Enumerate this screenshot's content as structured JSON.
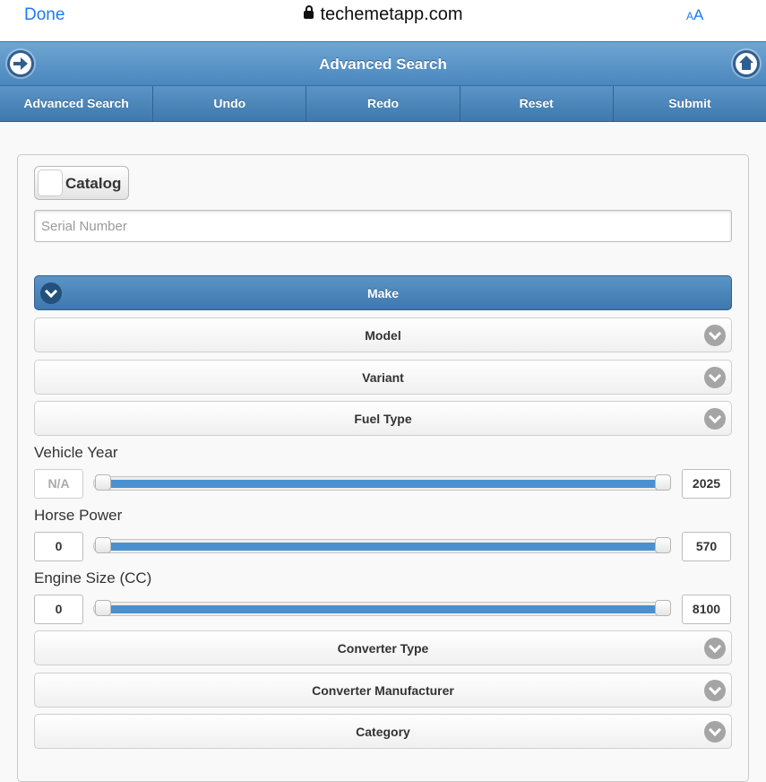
{
  "browser": {
    "done_label": "Done",
    "url": "techemetapp.com",
    "text_size_label_small": "A",
    "text_size_label_large": "A"
  },
  "header": {
    "title": "Advanced Search"
  },
  "navbar": {
    "items": [
      {
        "label": "Advanced Search"
      },
      {
        "label": "Undo"
      },
      {
        "label": "Redo"
      },
      {
        "label": "Reset"
      },
      {
        "label": "Submit"
      }
    ]
  },
  "form": {
    "catalog_label": "Catalog",
    "catalog_enabled": false,
    "serial_number": {
      "value": "",
      "placeholder": "Serial Number"
    },
    "sections": [
      {
        "label": "Make",
        "expanded": true
      },
      {
        "label": "Model",
        "expanded": false
      },
      {
        "label": "Variant",
        "expanded": false
      },
      {
        "label": "Fuel Type",
        "expanded": false
      }
    ],
    "sliders": [
      {
        "label": "Vehicle Year",
        "min_value": "N/A",
        "max_value": "2025",
        "min_disabled": true,
        "range_fraction": [
          0,
          1
        ]
      },
      {
        "label": "Horse Power",
        "min_value": "0",
        "max_value": "570",
        "min_disabled": false,
        "range_fraction": [
          0,
          1
        ]
      },
      {
        "label": "Engine Size (CC)",
        "min_value": "0",
        "max_value": "8100",
        "min_disabled": false,
        "range_fraction": [
          0,
          1
        ]
      }
    ],
    "lower_sections": [
      {
        "label": "Converter Type",
        "expanded": false
      },
      {
        "label": "Converter Manufacturer",
        "expanded": false
      },
      {
        "label": "Category",
        "expanded": false
      }
    ]
  },
  "colors": {
    "accent": "#4a87be",
    "link": "#1a7cf2",
    "slider_fill": "#4a90d0"
  }
}
